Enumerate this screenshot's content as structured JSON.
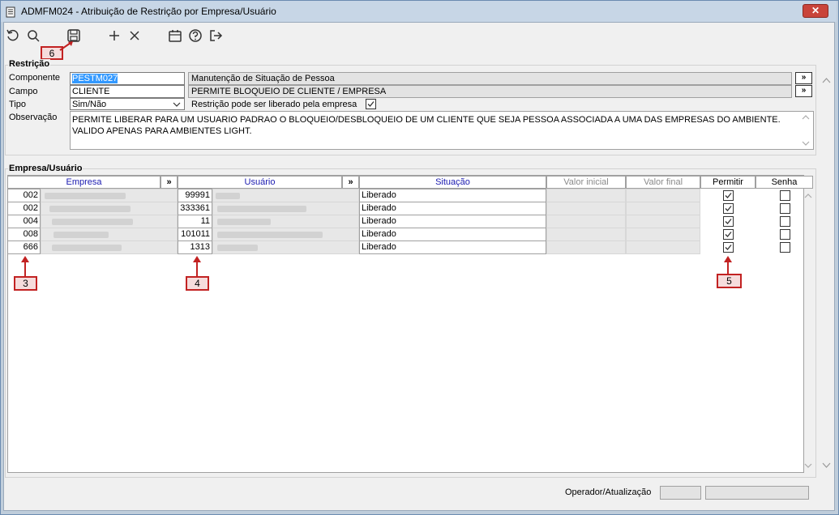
{
  "window": {
    "title": "ADMFM024 - Atribuição de Restrição por Empresa/Usuário",
    "close_label": "✕"
  },
  "toolbar": {
    "icons": [
      "refresh-icon",
      "search-icon",
      "save-icon",
      "add-icon",
      "delete-icon",
      "calendar-icon",
      "help-icon",
      "exit-icon"
    ]
  },
  "restricao": {
    "group_label": "Restrição",
    "componente_label": "Componente",
    "componente_value": "PESTM027",
    "componente_desc": "Manutenção de Situação de Pessoa",
    "campo_label": "Campo",
    "campo_value": "CLIENTE",
    "campo_desc": "PERMITE BLOQUEIO DE CLIENTE / EMPRESA",
    "tipo_label": "Tipo",
    "tipo_value": "Sim/Não",
    "liberado_label": "Restrição pode ser liberado pela empresa",
    "liberado_checked": true,
    "observacao_label": "Observação",
    "observacao_line1": "PERMITE LIBERAR PARA UM USUARIO PADRAO O BLOQUEIO/DESBLOQUEIO DE UM CLIENTE QUE SEJA PESSOA ASSOCIADA A UMA DAS EMPRESAS DO AMBIENTE.",
    "observacao_line2": "VALIDO APENAS PARA AMBIENTES LIGHT.",
    "more_label": "»"
  },
  "empresa_usuario": {
    "group_label": "Empresa/Usuário",
    "columns": {
      "empresa": "Empresa",
      "usuario": "Usuário",
      "situacao": "Situação",
      "valor_inicial": "Valor inicial",
      "valor_final": "Valor final",
      "permitir": "Permitir",
      "senha": "Senha",
      "more": "»"
    },
    "rows": [
      {
        "empresa": "002",
        "usuario": "99991",
        "situacao": "Liberado",
        "permitir": true,
        "senha": false
      },
      {
        "empresa": "002",
        "usuario": "333361",
        "situacao": "Liberado",
        "permitir": true,
        "senha": false
      },
      {
        "empresa": "004",
        "usuario": "11",
        "situacao": "Liberado",
        "permitir": true,
        "senha": false
      },
      {
        "empresa": "008",
        "usuario": "101011",
        "situacao": "Liberado",
        "permitir": true,
        "senha": false
      },
      {
        "empresa": "666",
        "usuario": "1313",
        "situacao": "Liberado",
        "permitir": true,
        "senha": false
      }
    ]
  },
  "status": {
    "operador_label": "Operador/Atualização"
  },
  "markers": {
    "m3": "3",
    "m4": "4",
    "m5": "5",
    "m6": "6"
  },
  "colors": {
    "marker_border": "#c22222",
    "header_blue": "#1a1ab0",
    "selection": "#3399ff"
  }
}
